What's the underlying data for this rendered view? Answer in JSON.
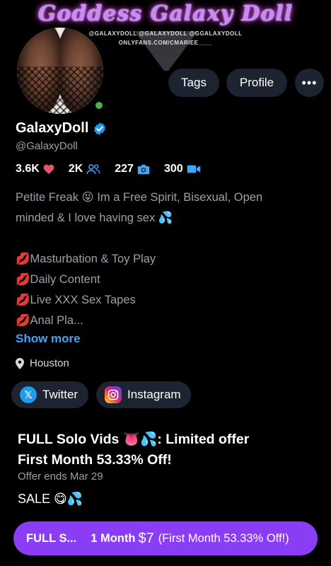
{
  "banner": {
    "title": "Goddess Galaxy Doll",
    "sub_line1": "@GALAXYDOLL   @GALAXYDOLL   @GGALAXYDOLL",
    "sub_line2": "ONLYFANS.COM/CMARIEE____"
  },
  "header_buttons": {
    "tags": "Tags",
    "profile": "Profile",
    "more": "•••"
  },
  "profile": {
    "display_name": "GalaxyDoll",
    "handle": "@GalaxyDoll",
    "online": true
  },
  "stats": {
    "likes": "3.6K",
    "fans": "2K",
    "photos": "227",
    "videos": "300"
  },
  "bio": {
    "line1": "Petite Freak 😝 Im a Free Spirit, Bisexual, Open",
    "line2": "minded & I love having sex 💦",
    "item1": "💋Masturbation & Toy Play",
    "item2": "💋Daily Content",
    "item3": "💋Live XXX Sex Tapes",
    "item4": "💋Anal Pla..."
  },
  "show_more": "Show more",
  "location": "Houston",
  "socials": {
    "twitter": "Twitter",
    "instagram": "Instagram"
  },
  "offer": {
    "title_line1": "FULL Solo Vids 👅💦: Limited offer",
    "title_line2": "First Month 53.33% Off!",
    "ends": "Offer ends Mar 29",
    "sale": "SALE 😋💦"
  },
  "cta": {
    "label": "FULL S...",
    "term": "1 Month",
    "price": "$7",
    "note": "(First Month 53.33% Off!)"
  },
  "colors": {
    "background": "#000000",
    "accent_purple": "#8b3df5",
    "link_blue": "#3ea6ff",
    "pill_bg": "#1d2330",
    "muted_text": "#9aa0ab",
    "online_green": "#4caf50"
  }
}
